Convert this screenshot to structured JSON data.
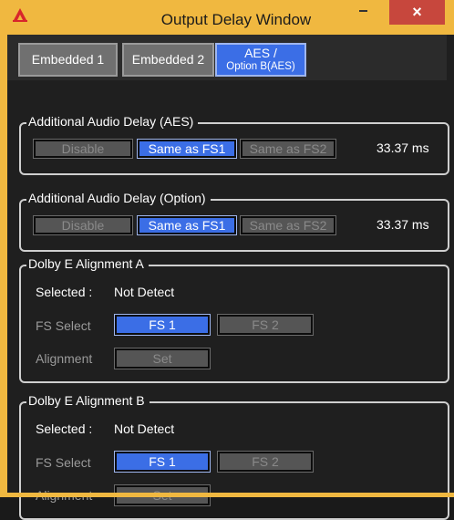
{
  "window": {
    "title": "Output Delay Window",
    "close_label": "×",
    "colors": {
      "frame": "#f0b840",
      "active": "#3b6ee6",
      "close": "#c7473d"
    }
  },
  "tabs": [
    {
      "label": "Embedded 1"
    },
    {
      "label": "Embedded 2"
    },
    {
      "label_line1": "AES /",
      "label_line2": "Option B(AES)",
      "active": true
    }
  ],
  "aes_delay": {
    "title": "Additional Audio Delay (AES)",
    "buttons": [
      "Disable",
      "Same as FS1",
      "Same as FS2"
    ],
    "selected": "Same as FS1",
    "value": "33.37 ms"
  },
  "option_delay": {
    "title": "Additional Audio Delay (Option)",
    "buttons": [
      "Disable",
      "Same as FS1",
      "Same as FS2"
    ],
    "selected": "Same as FS1",
    "value": "33.37 ms"
  },
  "dolby_a": {
    "title": "Dolby E Alignment A",
    "selected_label": "Selected :",
    "selected_value": "Not Detect",
    "fs_label": "FS Select",
    "fs_buttons": [
      "FS 1",
      "FS 2"
    ],
    "fs_selected": "FS 1",
    "align_label": "Alignment",
    "set_label": "Set"
  },
  "dolby_b": {
    "title": "Dolby E Alignment B",
    "selected_label": "Selected :",
    "selected_value": "Not Detect",
    "fs_label": "FS Select",
    "fs_buttons": [
      "FS 1",
      "FS 2"
    ],
    "fs_selected": "FS 1",
    "align_label": "Alignment",
    "set_label": "Set"
  }
}
